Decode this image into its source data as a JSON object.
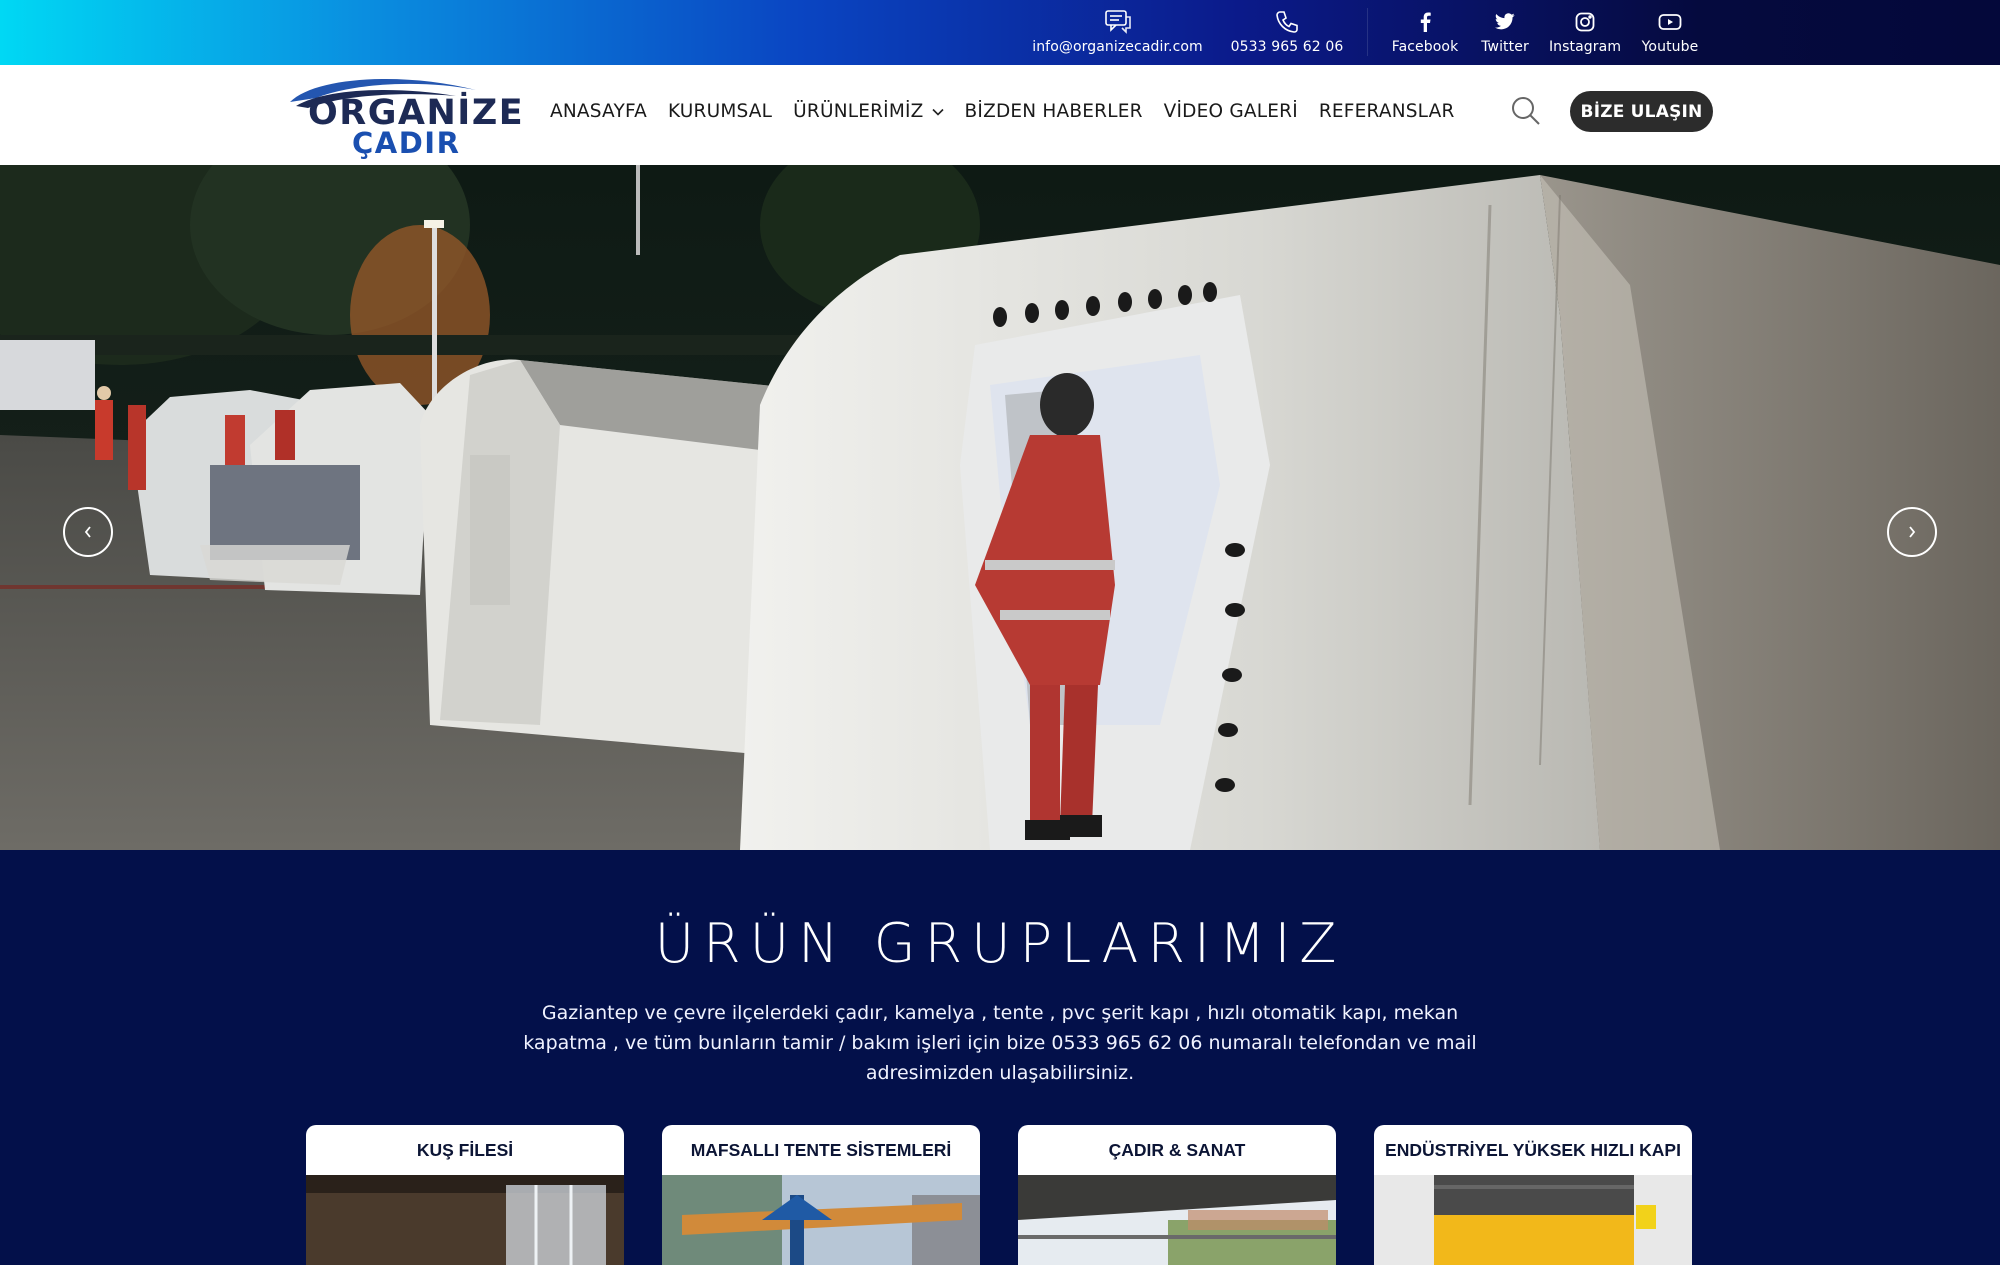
{
  "topbar": {
    "email": "info@organizecadir.com",
    "phone": "0533 965 62 06",
    "socials": [
      {
        "label": "Facebook",
        "icon": "facebook-icon"
      },
      {
        "label": "Twitter",
        "icon": "twitter-icon"
      },
      {
        "label": "Instagram",
        "icon": "instagram-icon"
      },
      {
        "label": "Youtube",
        "icon": "youtube-icon"
      }
    ]
  },
  "logo": {
    "line1": "ORGANİZE",
    "line2": "ÇADIR"
  },
  "nav": {
    "items": [
      "ANASAYFA",
      "KURUMSAL",
      "ÜRÜNLERİMİZ",
      "BİZDEN HABERLER",
      "VİDEO GALERİ",
      "REFERANSLAR"
    ],
    "search_icon": "search-icon",
    "cta": "BİZE ULAŞIN"
  },
  "hero": {
    "prev_icon": "chevron-left-icon",
    "next_icon": "chevron-right-icon"
  },
  "products": {
    "title": "ÜRÜN GRUPLARIMIZ",
    "description": "Gaziantep ve çevre ilçelerdeki çadır, kamelya , tente , pvc şerit kapı , hızlı otomatik kapı, mekan kapatma , ve tüm bunların tamir / bakım işleri için bize 0533 965 62 06 numaralı telefondan ve mail adresimizden ulaşabilirsiniz.",
    "cards": [
      {
        "title": "KUŞ FİLESİ"
      },
      {
        "title": "MAFSALLI TENTE SİSTEMLERİ"
      },
      {
        "title": "ÇADIR & SANAT"
      },
      {
        "title": "ENDÜSTRİYEL YÜKSEK HIZLI KAPI"
      }
    ]
  },
  "colors": {
    "navy": "#03104a",
    "cta_bg": "#2c2c2c",
    "gradient_start": "#00d8f4",
    "gradient_end": "#04083a"
  }
}
